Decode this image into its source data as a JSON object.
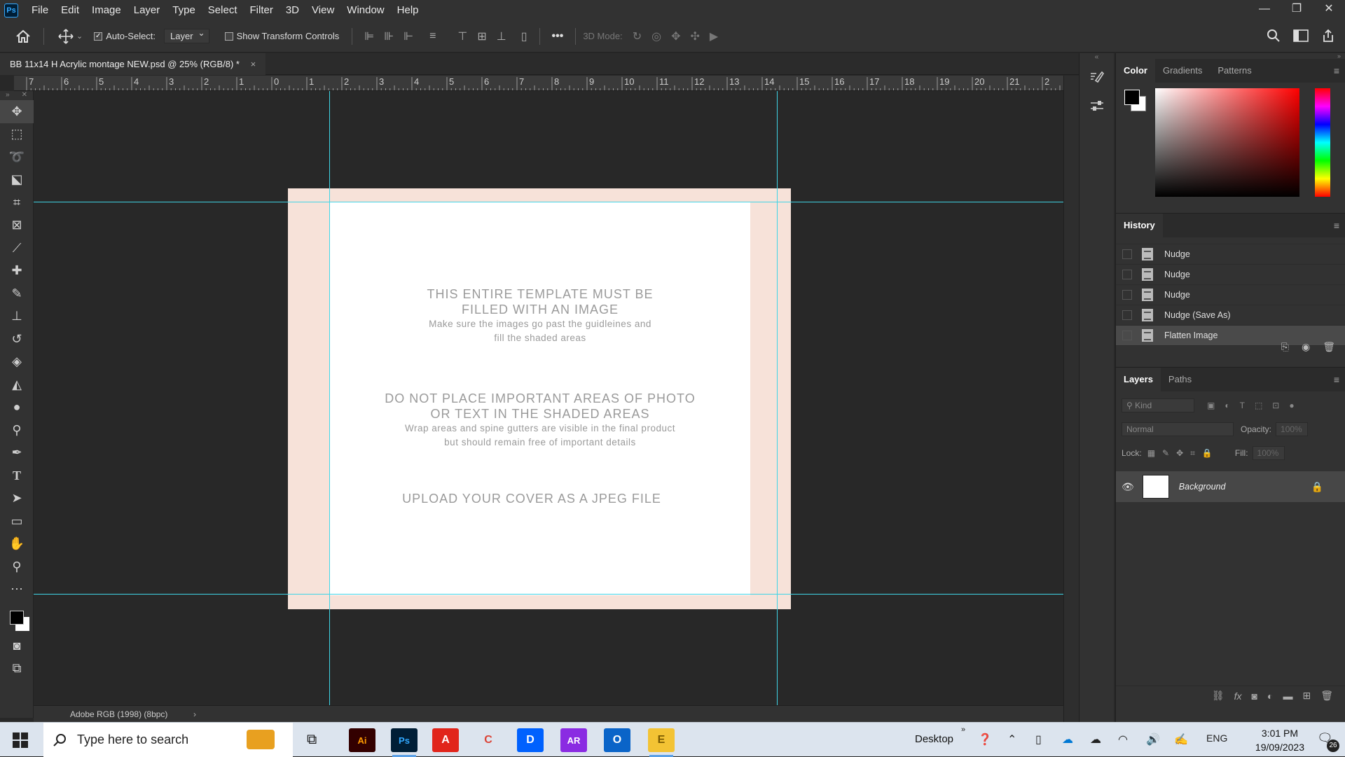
{
  "app": {
    "logo": "Ps"
  },
  "menu": [
    "File",
    "Edit",
    "Image",
    "Layer",
    "Type",
    "Select",
    "Filter",
    "3D",
    "View",
    "Window",
    "Help"
  ],
  "window_controls": {
    "minimize": "—",
    "restore": "❐",
    "close": "✕"
  },
  "options": {
    "auto_select_label": "Auto-Select:",
    "auto_select_checked": true,
    "layer_dropdown": "Layer",
    "transform_label": "Show Transform Controls",
    "mode_3d_label": "3D Mode:"
  },
  "document": {
    "tab_title": "BB 11x14 H Acrylic montage NEW.psd @ 25% (RGB/8) *",
    "close": "×",
    "ruler_marks": [
      "7",
      "6",
      "5",
      "4",
      "3",
      "2",
      "1",
      "0",
      "1",
      "2",
      "3",
      "4",
      "5",
      "6",
      "7",
      "8",
      "9",
      "10",
      "11",
      "12",
      "13",
      "14",
      "15",
      "16",
      "17",
      "18",
      "19",
      "20",
      "21",
      "2"
    ]
  },
  "canvas": {
    "heading1_line1": "THIS ENTIRE TEMPLATE MUST BE",
    "heading1_line2": "FILLED WITH AN IMAGE",
    "sub1_line1": "Make sure the images go past the guidleines and",
    "sub1_line2": "fill the shaded areas",
    "heading2_line1": "DO NOT PLACE IMPORTANT AREAS OF PHOTO",
    "heading2_line2": "OR TEXT IN THE SHADED AREAS",
    "sub2_line1": "Wrap areas and spine gutters are visible in the final product",
    "sub2_line2": "but should remain free of important details",
    "heading3": "UPLOAD YOUR COVER AS A JPEG FILE",
    "wrap_color": "#f7e2d9",
    "guide_color": "#3fd4e6"
  },
  "status": {
    "profile": "Adobe RGB (1998) (8bpc)",
    "arrow": "›"
  },
  "panels": {
    "color_tabs": [
      "Color",
      "Gradients",
      "Patterns"
    ],
    "history_title": "History",
    "history_items": [
      "Nudge",
      "Nudge",
      "Nudge",
      "Nudge (Save As)",
      "Flatten Image"
    ],
    "layers_tabs": [
      "Layers",
      "Paths"
    ],
    "kind_placeholder": "Kind",
    "blend_mode": "Normal",
    "opacity_label": "Opacity:",
    "opacity_value": "100%",
    "lock_label": "Lock:",
    "fill_label": "Fill:",
    "fill_value": "100%",
    "layer_name": "Background"
  },
  "taskbar": {
    "search_placeholder": "Type here to search",
    "apps": [
      {
        "name": "Ai",
        "bg": "#330000",
        "fg": "#ff9a00"
      },
      {
        "name": "Ps",
        "bg": "#001e36",
        "fg": "#31a8ff"
      },
      {
        "name": "Acrobat",
        "bg": "#e1251b",
        "fg": "#fff"
      },
      {
        "name": "Chrome",
        "bg": "#dce4ee",
        "fg": "#db4437"
      },
      {
        "name": "Dropbox",
        "bg": "#0061fe",
        "fg": "#fff"
      },
      {
        "name": "AR",
        "bg": "#8a2be2",
        "fg": "#fff"
      },
      {
        "name": "Outlook",
        "bg": "#0a64c8",
        "fg": "#fff"
      },
      {
        "name": "Explorer",
        "bg": "#f3c334",
        "fg": "#7a5a00"
      }
    ],
    "desktop_label": "Desktop",
    "lang": "ENG",
    "time": "3:01 PM",
    "date": "19/09/2023",
    "notifications": "26"
  }
}
